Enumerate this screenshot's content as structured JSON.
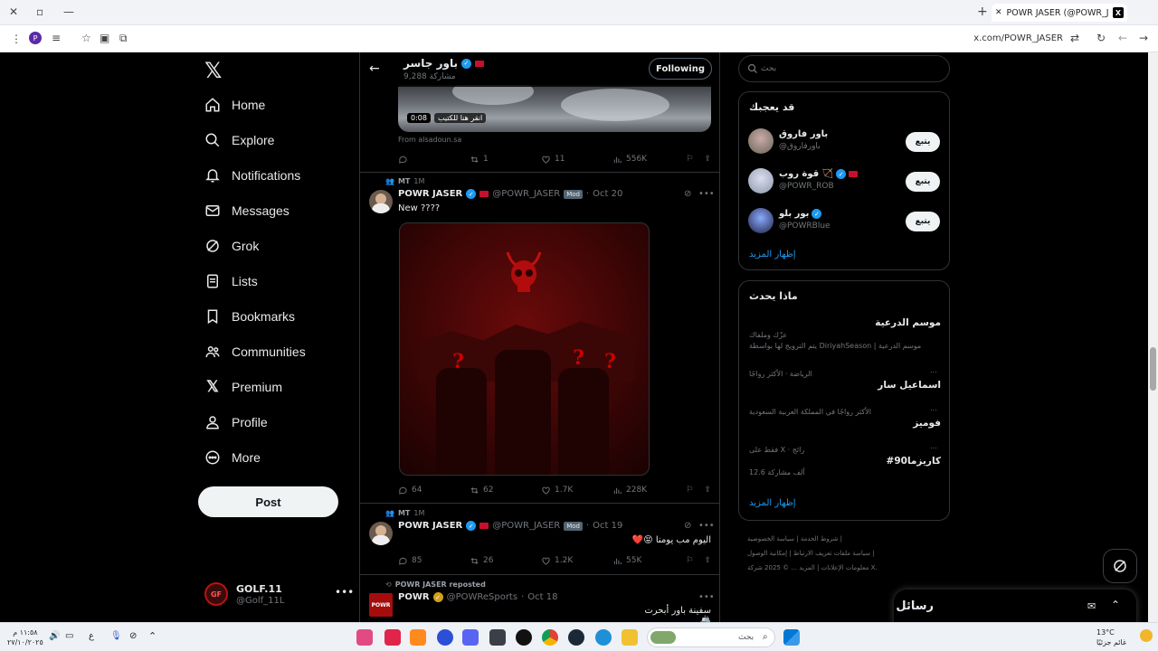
{
  "browser": {
    "tab_title": "POWR JASER (@POWR_JASER)",
    "url": "x.com/POWR_JASER",
    "profile_initial": "P"
  },
  "nav": {
    "items": [
      {
        "key": "home",
        "label": "Home"
      },
      {
        "key": "explore",
        "label": "Explore"
      },
      {
        "key": "notifications",
        "label": "Notifications"
      },
      {
        "key": "messages",
        "label": "Messages"
      },
      {
        "key": "grok",
        "label": "Grok"
      },
      {
        "key": "lists",
        "label": "Lists"
      },
      {
        "key": "bookmarks",
        "label": "Bookmarks"
      },
      {
        "key": "communities",
        "label": "Communities"
      },
      {
        "key": "premium",
        "label": "Premium"
      },
      {
        "key": "profile",
        "label": "Profile"
      },
      {
        "key": "more",
        "label": "More"
      }
    ],
    "post_label": "Post",
    "account": {
      "name": "GOLF.11",
      "handle": "@Golf_11L",
      "avatar_text": "GF"
    }
  },
  "header": {
    "profile_name": "باور جاسر",
    "posts_count": "9,288 مشاركة",
    "follow_label": "Following"
  },
  "tweets": [
    {
      "video_time": "0:08",
      "video_caption": "انقر هنا للكتيب",
      "source": "From alsadoun.sa",
      "replies": "",
      "reposts": "1",
      "likes": "11",
      "views": "556K"
    },
    {
      "context": "MT",
      "context_time": "1M",
      "name": "POWR JASER",
      "handle": "@POWR_JASER",
      "mod": "Mod",
      "date": "Oct 20",
      "text": "New ????",
      "replies": "64",
      "reposts": "62",
      "likes": "1.7K",
      "views": "228K"
    },
    {
      "context": "MT",
      "context_time": "1M",
      "name": "POWR JASER",
      "handle": "@POWR_JASER",
      "mod": "Mod",
      "date": "Oct 19",
      "text": "اليوم مب يومنا 😝❤️",
      "replies": "85",
      "reposts": "26",
      "likes": "1.2K",
      "views": "55K"
    },
    {
      "context": "POWR JASER reposted",
      "name": "POWR",
      "handle": "@POWReSports",
      "date": "Oct 18",
      "text": "سفينة باور أبحرت 🚢",
      "avatar_text": "POWR"
    }
  ],
  "right": {
    "search_placeholder": "بحث",
    "suggest_title": "قد يعجبك",
    "suggestions": [
      {
        "name": "باور فاروق",
        "handle": "@باورفاروق",
        "follow": "يتبع"
      },
      {
        "name": "قوة روب 🏹",
        "handle": "@POWR_ROB",
        "follow": "يتبع"
      },
      {
        "name": "بور بلو",
        "handle": "@POWRBlue",
        "follow": "يتبع"
      }
    ],
    "show_more": "إظهار المزيد",
    "trends_title": "ماذا يحدث",
    "trends": [
      {
        "title": "موسم الدرعية",
        "sub": "عزّك وملفاك",
        "meta": "يتم الترويج لها بواسطة DiriyahSeason | موسم الدرعية"
      },
      {
        "meta": "الرياضة · الأكثر رواجًا",
        "title": "اسماعيل سار"
      },
      {
        "meta": "الأكثر رواجًا في المملكة العربية السعودية",
        "title": "فوميز"
      },
      {
        "meta": "فقط على X · رائج",
        "title": "#كاريزما90",
        "count": "12.6 ألف مشاركة"
      }
    ],
    "footer": {
      "line1": "شروط الخدمة | سياسة الخصوصية |",
      "line2": "سياسة ملفات تعريف الارتباط | إمكانية الوصول |",
      "line3": "معلومات الإعلانات | المزيد ... © 2025 شركة X."
    }
  },
  "messages": {
    "title": "رسائل"
  },
  "taskbar": {
    "search_placeholder": "بحث",
    "time": "١١:٥٨ م",
    "date": "٢٧/١٠/٢٠٢٥",
    "temp": "13°C",
    "weather": "غائم جزئيًا"
  },
  "colors": {
    "accent": "#1d9bf0",
    "verified": "#1d9bf0",
    "badge": "#c8102e"
  }
}
